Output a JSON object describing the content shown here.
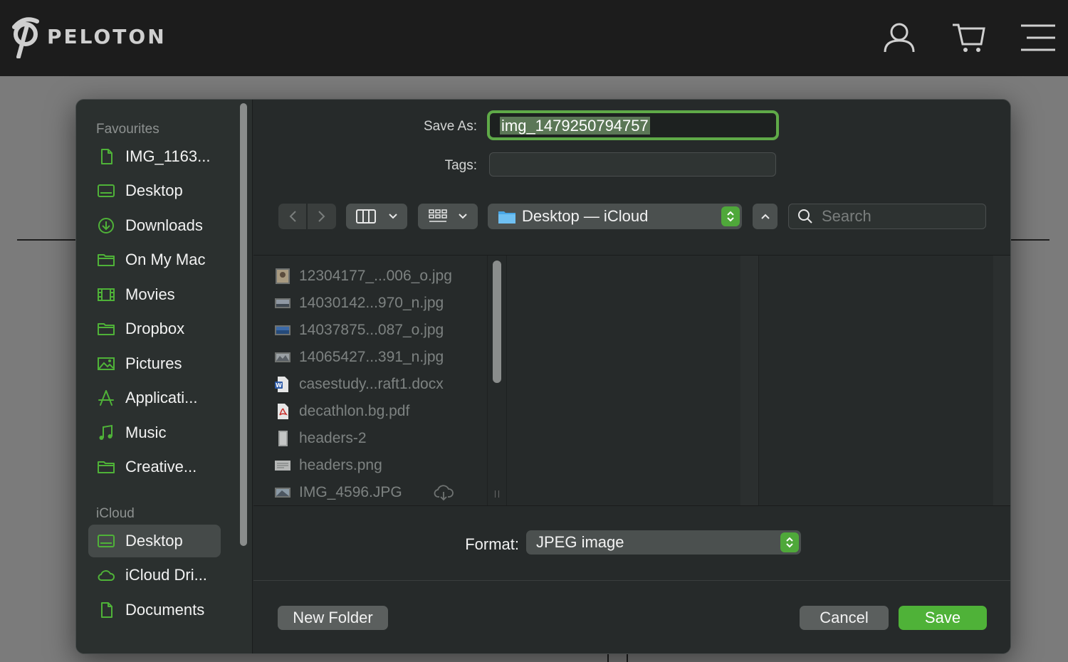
{
  "site": {
    "brand": "PELOTON",
    "icons": [
      "peloton-logo-icon",
      "account-icon",
      "cart-icon",
      "menu-icon"
    ]
  },
  "dialog": {
    "save_as_label": "Save As:",
    "save_as_value": "img_1479250794757",
    "tags_label": "Tags:",
    "location": "Desktop — iCloud",
    "search_placeholder": "Search",
    "format_label": "Format:",
    "format_value": "JPEG image",
    "new_folder_label": "New Folder",
    "cancel_label": "Cancel",
    "save_label": "Save",
    "accent_color": "#4fb238"
  },
  "sidebar": {
    "favourites_label": "Favourites",
    "favourites": [
      {
        "label": "IMG_1163...",
        "icon": "document-icon"
      },
      {
        "label": "Desktop",
        "icon": "desktop-icon"
      },
      {
        "label": "Downloads",
        "icon": "download-icon"
      },
      {
        "label": "On My Mac",
        "icon": "folder-icon"
      },
      {
        "label": "Movies",
        "icon": "film-icon"
      },
      {
        "label": "Dropbox",
        "icon": "folder-icon"
      },
      {
        "label": "Pictures",
        "icon": "photo-icon"
      },
      {
        "label": "Applicati...",
        "icon": "applications-icon"
      },
      {
        "label": "Music",
        "icon": "music-icon"
      },
      {
        "label": "Creative...",
        "icon": "folder-icon"
      }
    ],
    "icloud_label": "iCloud",
    "icloud": [
      {
        "label": "Desktop",
        "icon": "desktop-icon",
        "selected": true
      },
      {
        "label": "iCloud Dri...",
        "icon": "cloud-icon"
      },
      {
        "label": "Documents",
        "icon": "document-icon"
      }
    ]
  },
  "files": [
    {
      "name": "12304177_...006_o.jpg",
      "icon": "image-thumbnail-icon"
    },
    {
      "name": "14030142...970_n.jpg",
      "icon": "image-thumbnail-icon"
    },
    {
      "name": "14037875...087_o.jpg",
      "icon": "image-thumbnail-icon"
    },
    {
      "name": "14065427...391_n.jpg",
      "icon": "image-thumbnail-icon"
    },
    {
      "name": "casestudy...raft1.docx",
      "icon": "word-doc-icon"
    },
    {
      "name": "decathlon.bg.pdf",
      "icon": "pdf-icon"
    },
    {
      "name": "headers-2",
      "icon": "file-icon"
    },
    {
      "name": "headers.png",
      "icon": "image-thumbnail-icon"
    },
    {
      "name": "IMG_4596.JPG",
      "icon": "image-thumbnail-icon",
      "status_icon": "cloud-download-icon"
    }
  ]
}
